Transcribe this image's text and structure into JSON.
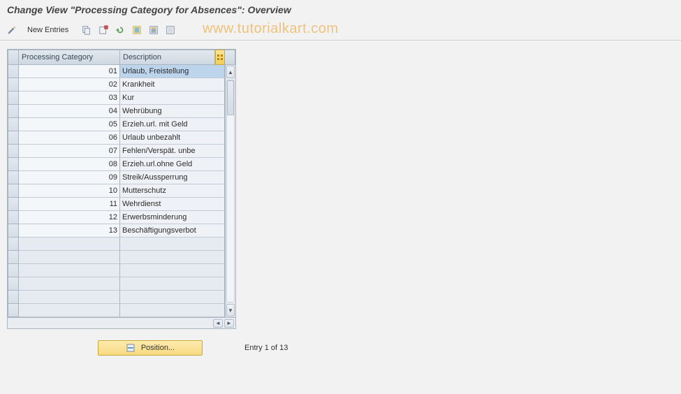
{
  "title": "Change View \"Processing Category for Absences\": Overview",
  "toolbar": {
    "new_entries": "New Entries"
  },
  "watermark": "www.tutorialkart.com",
  "table": {
    "headers": {
      "processing_category": "Processing Category",
      "description": "Description"
    },
    "rows": [
      {
        "cat": "01",
        "desc": "Urlaub, Freistellung",
        "selected": true
      },
      {
        "cat": "02",
        "desc": "Krankheit"
      },
      {
        "cat": "03",
        "desc": "Kur"
      },
      {
        "cat": "04",
        "desc": "Wehrübung"
      },
      {
        "cat": "05",
        "desc": "Erzieh.url. mit Geld"
      },
      {
        "cat": "06",
        "desc": "Urlaub unbezahlt"
      },
      {
        "cat": "07",
        "desc": "Fehlen/Verspät. unbe"
      },
      {
        "cat": "08",
        "desc": "Erzieh.url.ohne Geld"
      },
      {
        "cat": "09",
        "desc": "Streik/Aussperrung"
      },
      {
        "cat": "10",
        "desc": "Mutterschutz"
      },
      {
        "cat": "11",
        "desc": "Wehrdienst"
      },
      {
        "cat": "12",
        "desc": "Erwerbsminderung"
      },
      {
        "cat": "13",
        "desc": "Beschäftigungsverbot"
      }
    ],
    "empty_rows": 6
  },
  "footer": {
    "position_label": "Position...",
    "entry_text": "Entry 1 of 13"
  }
}
